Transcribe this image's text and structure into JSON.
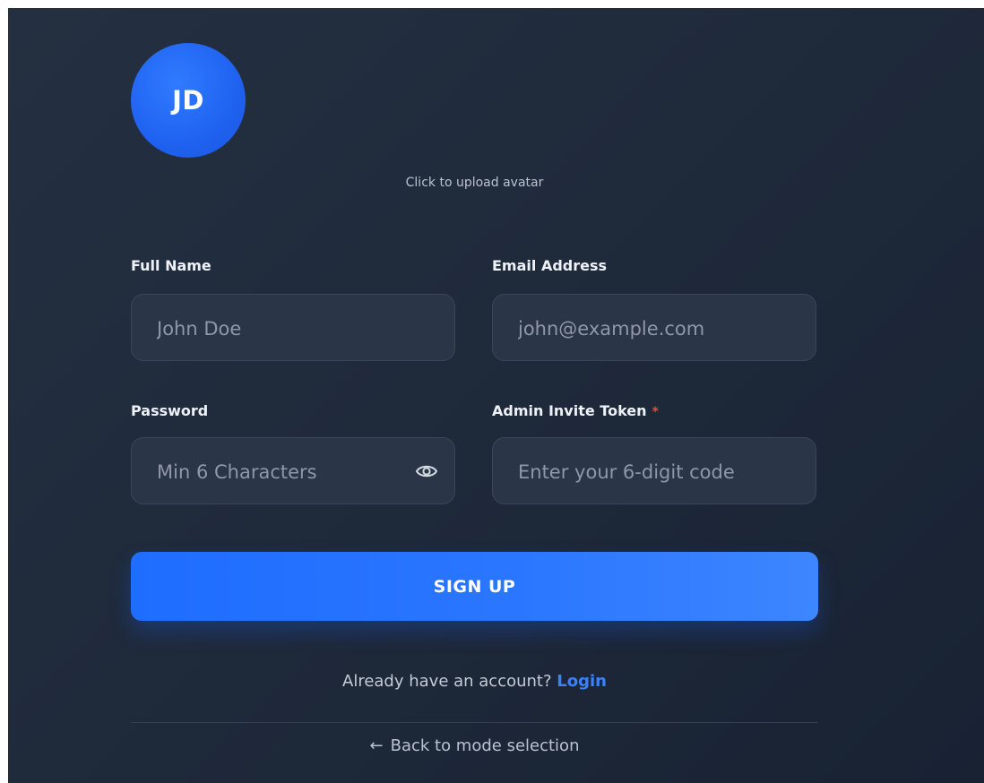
{
  "avatar": {
    "initials": "JD",
    "upload_hint": "Click to upload avatar"
  },
  "form": {
    "full_name": {
      "label": "Full Name",
      "placeholder": "John Doe",
      "value": ""
    },
    "email": {
      "label": "Email Address",
      "placeholder": "john@example.com",
      "value": ""
    },
    "password": {
      "label": "Password",
      "placeholder": "Min 6 Characters",
      "value": "",
      "toggle_icon": "eye-icon"
    },
    "invite_token": {
      "label": "Admin Invite Token",
      "required_marker": "*",
      "placeholder": "Enter your 6-digit code",
      "value": ""
    }
  },
  "actions": {
    "signup_label": "SIGN UP",
    "login_prompt": "Already have an account?",
    "login_link": "Login",
    "back_arrow": "←",
    "back_label": "Back to mode selection"
  },
  "colors": {
    "accent": "#2a76ff",
    "link": "#3b82f6",
    "required": "#ef4444",
    "background": "#1f2a3b"
  }
}
